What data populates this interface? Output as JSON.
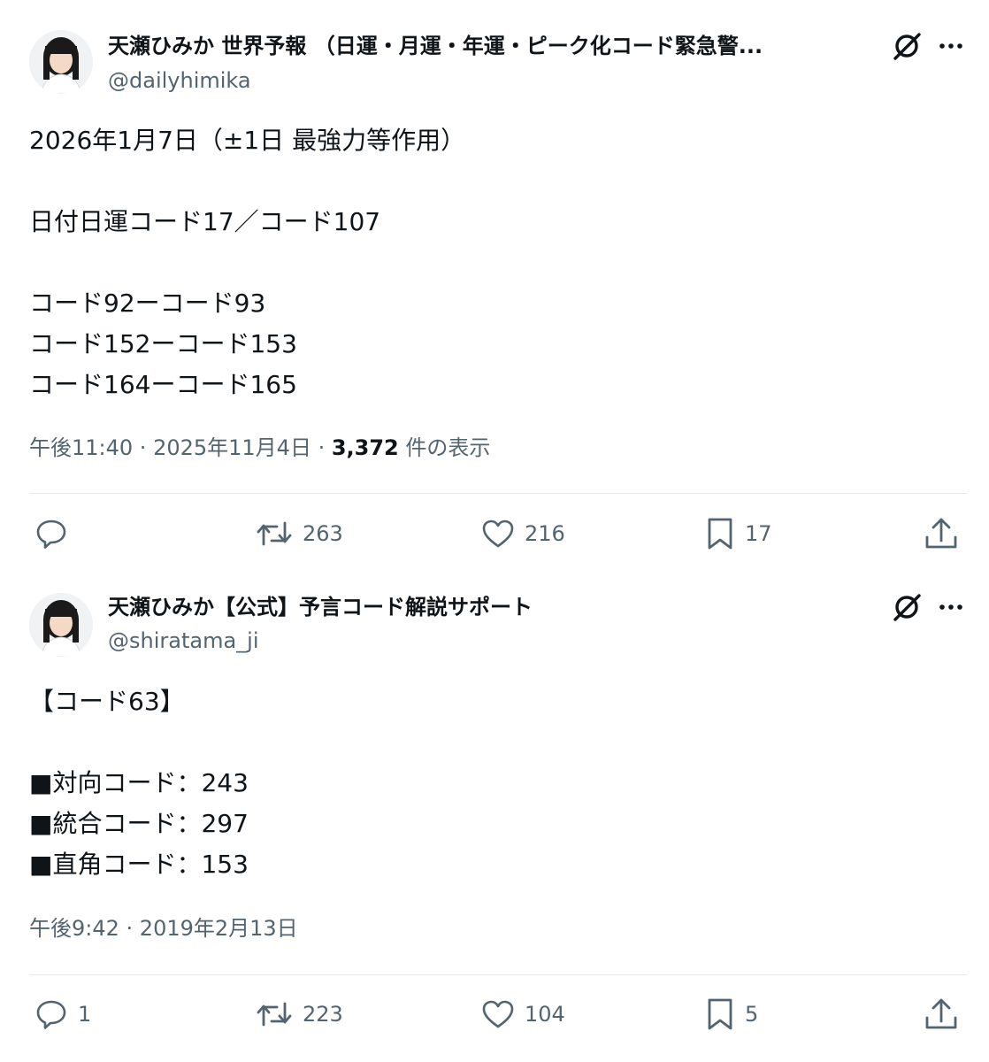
{
  "tweets": [
    {
      "display_name": "天瀬ひみか 世界予報 （日運・月運・年運・ピーク化コード緊急警...",
      "handle": "@dailyhimika",
      "lines": [
        "2026年1月7日（±1日 最強力等作用）",
        "",
        "日付日運コード17／コード107",
        "",
        "コード92ーコード93",
        "コード152ーコード153",
        "コード164ーコード165"
      ],
      "time": "午後11:40",
      "separator": " · ",
      "date": "2025年11月4日",
      "views_count": "3,372",
      "views_label": "件の表示",
      "actions": {
        "replies": "",
        "retweets": "263",
        "likes": "216",
        "bookmarks": "17"
      }
    },
    {
      "display_name": "天瀬ひみか【公式】予言コード解説サポート",
      "handle": "@shiratama_ji",
      "lines": [
        "【コード63】",
        "",
        "■対向コード：243",
        "■統合コード：297",
        "■直角コード：153"
      ],
      "time": "午後9:42",
      "separator": " · ",
      "date": "2019年2月13日",
      "views_count": "",
      "views_label": "",
      "actions": {
        "replies": "1",
        "retweets": "223",
        "likes": "104",
        "bookmarks": "5"
      }
    }
  ],
  "icons": [
    "avatar",
    "grok-icon",
    "more-icon",
    "reply-icon",
    "retweet-icon",
    "like-icon",
    "bookmark-icon",
    "share-icon"
  ],
  "colors": {
    "text": "#0f1419",
    "secondary": "#536471",
    "divider": "#e6e9eb"
  }
}
